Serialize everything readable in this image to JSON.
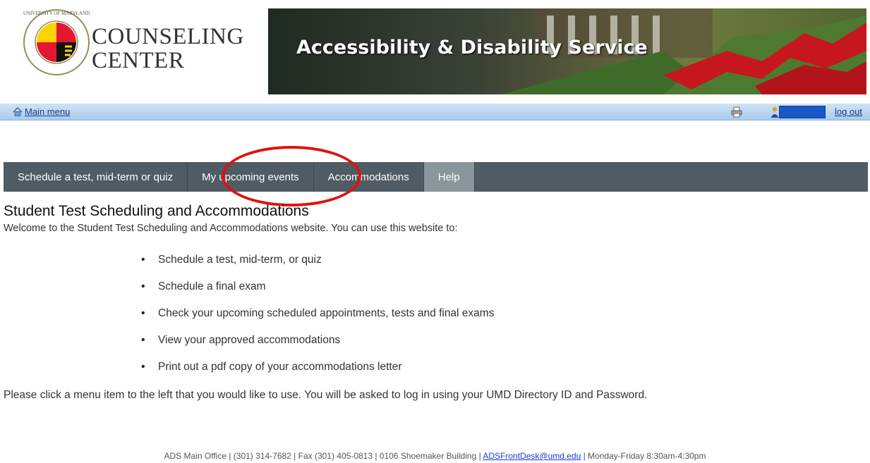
{
  "header": {
    "logo_line1": "COUNSELING",
    "logo_line2": "CENTER",
    "seal_text": "UNIVERSITY OF MARYLAND",
    "banner_title": "Accessibility & Disability Service"
  },
  "topbar": {
    "main_menu_label": "Main menu",
    "logout_label": "log out"
  },
  "nav": {
    "tabs": [
      {
        "label": "Schedule a test, mid-term or quiz"
      },
      {
        "label": "My upcoming events"
      },
      {
        "label": "Accommodations"
      },
      {
        "label": "Help"
      }
    ]
  },
  "main": {
    "title": "Student Test Scheduling and Accommodations",
    "intro": "Welcome to the Student Test Scheduling and Accommodations website. You can use this website to:",
    "features": [
      "Schedule a test, mid-term, or quiz",
      "Schedule a final exam",
      "Check your upcoming scheduled appointments, tests and final exams",
      "View your approved accommodations",
      "Print out a pdf copy of your accommodations letter"
    ],
    "note": "Please click a menu item to the left that you would like to use. You will be asked to log in using your UMD Directory ID and Password."
  },
  "footer": {
    "before_email": "ADS Main Office | (301) 314-7682 | Fax (301) 405-0813 | 0106 Shoemaker Building |",
    "email": "ADSFrontDesk@umd.edu",
    "after_email": "| Monday-Friday 8:30am-4:30pm"
  },
  "colors": {
    "nav_bg": "#4f5c63",
    "help_tab_bg": "#8a969c",
    "highlight": "#e01111",
    "topbar_bg": "#b8d5ef",
    "link": "#1a3c8a"
  }
}
